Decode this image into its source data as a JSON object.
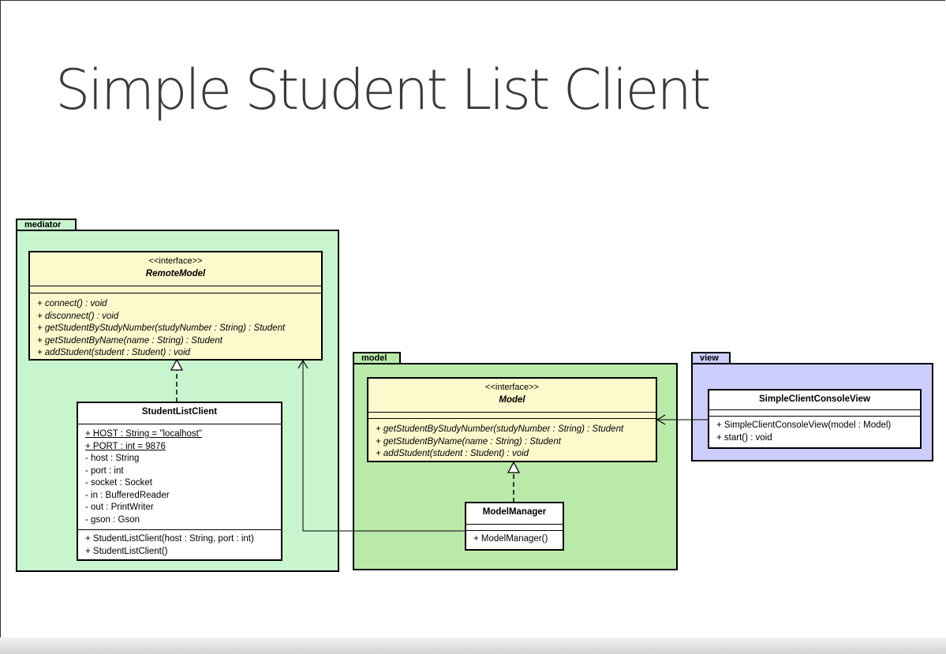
{
  "slide": {
    "title": "Simple Student List Client"
  },
  "colors": {
    "mediator_pkg": "#c8f5cd",
    "model_pkg": "#baeaaa",
    "view_pkg": "#cccdfc",
    "interface_fill": "#fdf9cd",
    "class_fill": "#ffffff"
  },
  "packages": {
    "mediator": {
      "name": "mediator"
    },
    "model": {
      "name": "model"
    },
    "view": {
      "name": "view"
    }
  },
  "classes": {
    "remote_model": {
      "stereotype": "<<interface>>",
      "name": "RemoteModel",
      "operations": [
        "+ connect() : void",
        "+ disconnect() : void",
        "+ getStudentByStudyNumber(studyNumber : String) : Student",
        "+ getStudentByName(name : String) : Student",
        "+ addStudent(student : Student) : void"
      ]
    },
    "student_list_client": {
      "name": "StudentListClient",
      "attributes": [
        "+ HOST : String = \"localhost\"",
        "+ PORT : int = 9876",
        "- host : String",
        "- port : int",
        "- socket : Socket",
        "- in : BufferedReader",
        "- out : PrintWriter",
        "- gson : Gson"
      ],
      "operations": [
        "+ StudentListClient(host : String, port : int)",
        "+ StudentListClient()"
      ]
    },
    "model": {
      "stereotype": "<<interface>>",
      "name": "Model",
      "operations": [
        "+ getStudentByStudyNumber(studyNumber : String) : Student",
        "+ getStudentByName(name : String) : Student",
        "+ addStudent(student : Student) : void"
      ]
    },
    "model_manager": {
      "name": "ModelManager",
      "operations": [
        "+ ModelManager()"
      ]
    },
    "simple_client_console_view": {
      "name": "SimpleClientConsoleView",
      "operations": [
        "+ SimpleClientConsoleView(model : Model)",
        "+ start() : void"
      ]
    }
  }
}
